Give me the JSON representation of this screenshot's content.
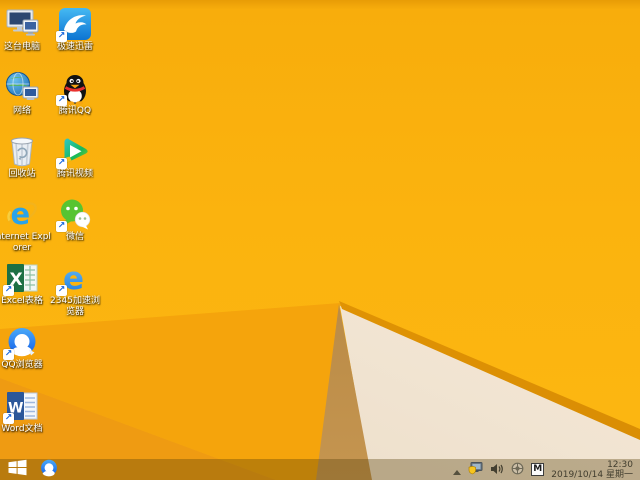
{
  "wallpaper": {
    "base_color": "#FBB30E",
    "fold_mid_color": "#F5A40C",
    "fold_deep_color": "#EF9B12",
    "fold_shadow_color": "#B9894A",
    "fold_cream_color": "#F2E5D3",
    "fold_edge_color": "#DE8E04"
  },
  "desktop": {
    "icons": [
      {
        "label": "这台电脑",
        "icon": "this-pc-icon",
        "shortcut": false
      },
      {
        "label": "极速迅雷",
        "icon": "thunder-icon",
        "shortcut": true
      },
      {
        "label": "网络",
        "icon": "network-icon",
        "shortcut": false
      },
      {
        "label": "腾讯QQ",
        "icon": "qq-icon",
        "shortcut": true
      },
      {
        "label": "回收站",
        "icon": "recycle-bin-icon",
        "shortcut": false
      },
      {
        "label": "腾讯视频",
        "icon": "tencent-video-icon",
        "shortcut": true
      },
      {
        "label": "Internet Explorer",
        "icon": "internet-explorer-icon",
        "shortcut": false
      },
      {
        "label": "微信",
        "icon": "wechat-icon",
        "shortcut": true
      },
      {
        "label": "Excel表格",
        "icon": "excel-icon",
        "shortcut": true
      },
      {
        "label": "2345加速浏览器",
        "icon": "2345-browser-icon",
        "shortcut": true
      },
      {
        "label": "QQ浏览器",
        "icon": "qq-browser-icon",
        "shortcut": true
      },
      {
        "label": "Word文档",
        "icon": "word-icon",
        "shortcut": true
      }
    ],
    "shortcut_arrow": "↗"
  },
  "taskbar": {
    "pinned": [
      {
        "icon": "start-icon"
      },
      {
        "icon": "qq-browser-taskbar-icon"
      }
    ],
    "tray": {
      "icons": [
        "show-hidden-icon",
        "security-status-icon",
        "volume-icon",
        "utility-wheel-icon"
      ],
      "ime_indicator": "M",
      "time": "12:30",
      "date": "2019/10/14 星期一"
    }
  }
}
